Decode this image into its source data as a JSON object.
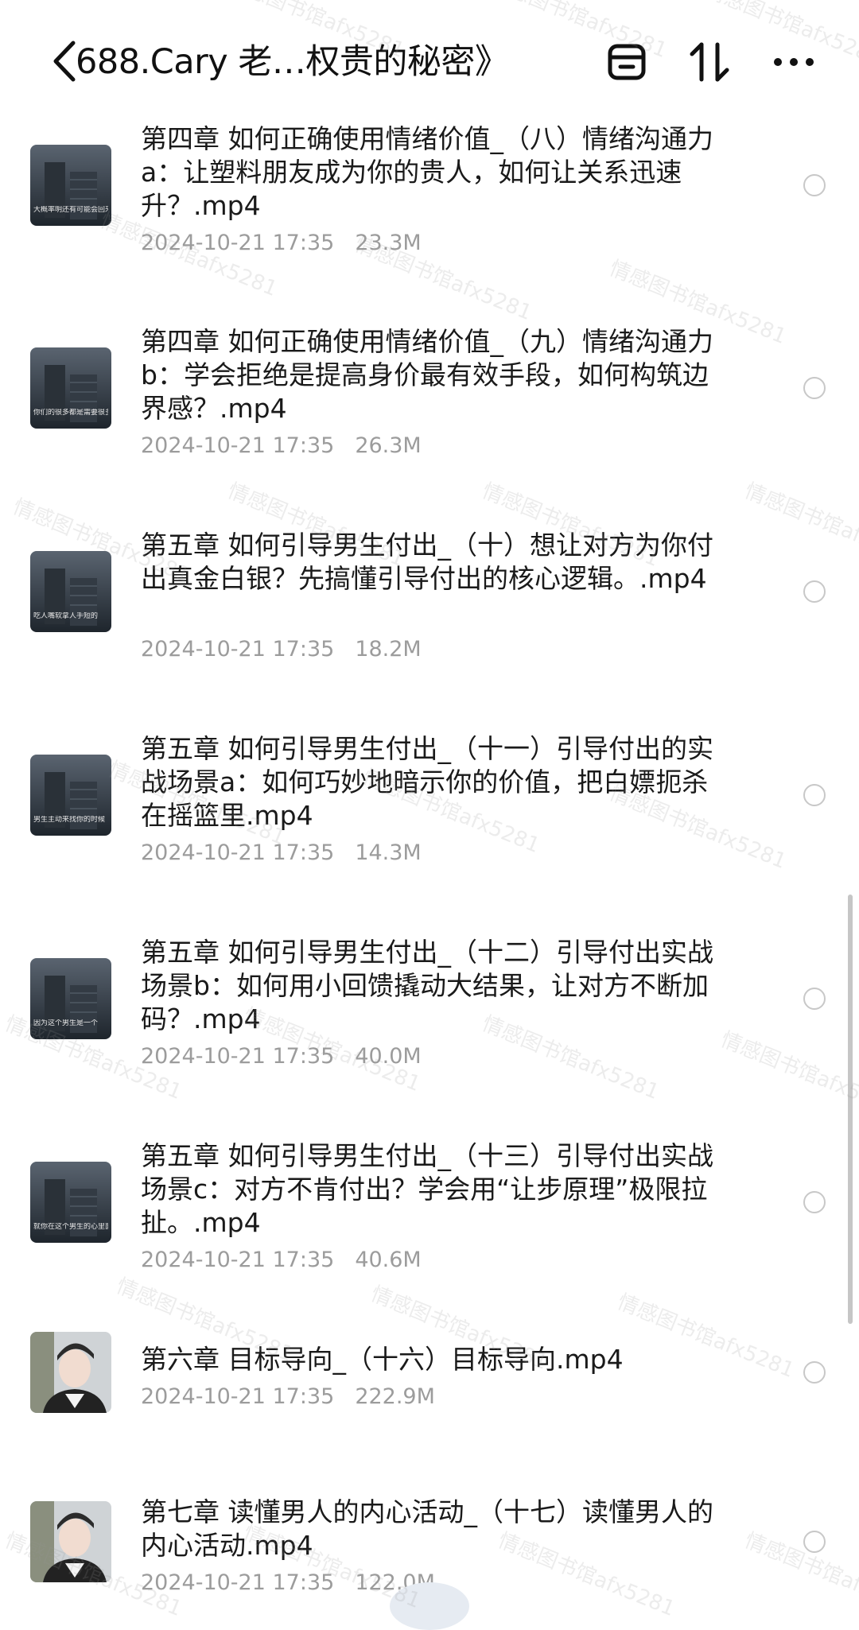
{
  "header": {
    "title": "688.Cary 老…权贵的秘密》",
    "back_icon": "chevron-left-icon",
    "icons": [
      "window-icon",
      "sort-icon",
      "more-icon"
    ]
  },
  "watermark_text": "情感图书馆afx5281",
  "files": [
    {
      "name": "第四章 如何正确使用情绪价值_（八）情绪沟通力a：让塑料朋友成为你的贵人，如何让关系迅速升？.mp4",
      "date": "2024-10-21 17:35",
      "size": "23.3M",
      "thumb_text": "大概率明还有可能会回来哦"
    },
    {
      "name": "第四章 如何正确使用情绪价值_（九）情绪沟通力b：学会拒绝是提高身价最有效手段，如何构筑边界感？.mp4",
      "date": "2024-10-21 17:35",
      "size": "26.3M",
      "thumb_text": "你们的很多都是需要很多"
    },
    {
      "name": "第五章 如何引导男生付出_（十）想让对方为你付出真金白银？先搞懂引导付出的核心逻辑。.mp4",
      "date": "2024-10-21 17:35",
      "size": "18.2M",
      "thumb_text": "吃人嘴软拿人手短的"
    },
    {
      "name": "第五章 如何引导男生付出_（十一）引导付出的实战场景a：如何巧妙地暗示你的价值，把白嫖扼杀在摇篮里.mp4",
      "date": "2024-10-21 17:35",
      "size": "14.3M",
      "thumb_text": "男生主动来找你的时候"
    },
    {
      "name": "第五章 如何引导男生付出_（十二）引导付出实战场景b：如何用小回馈撬动大结果，让对方不断加码？.mp4",
      "date": "2024-10-21 17:35",
      "size": "40.0M",
      "thumb_text": "因为这个男生是一个"
    },
    {
      "name": "第五章 如何引导男生付出_（十三）引导付出实战场景c：对方不肯付出？学会用“让步原理”极限拉扯。.mp4",
      "date": "2024-10-21 17:35",
      "size": "40.6M",
      "thumb_text": "就你在这个男生的心里面"
    },
    {
      "name": "第六章 目标导向_（十六）目标导向.mp4",
      "date": "2024-10-21 17:35",
      "size": "222.9M",
      "thumb_text": ""
    },
    {
      "name": "第七章 读懂男人的内心活动_（十七）读懂男人的内心活动.mp4",
      "date": "2024-10-21 17:35",
      "size": "122.0M",
      "thumb_text": ""
    }
  ],
  "colors": {
    "text": "#1a1a1a",
    "meta": "#9c9c9c",
    "thumb_dark": "#3a4450"
  }
}
